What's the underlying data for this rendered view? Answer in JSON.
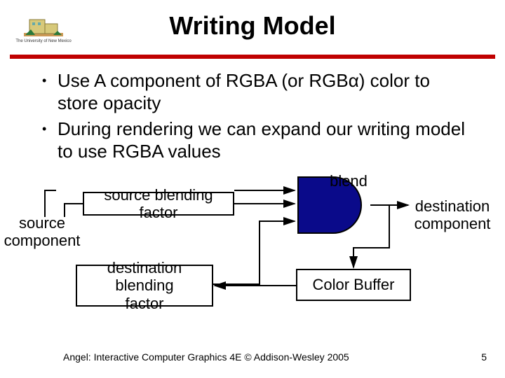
{
  "logo_caption": "The University of New Mexico",
  "title": "Writing Model",
  "bullets": [
    "Use A component of RGBA (or RGBα) color to store opacity",
    "During rendering we can expand our writing model to use RGBA values"
  ],
  "diagram": {
    "source_component": "source\ncomponent",
    "src_blend_box": "source blending factor",
    "dst_blend_box": "destination blending\nfactor",
    "blend_label": "blend",
    "destination_component": "destination\ncomponent",
    "color_buffer": "Color Buffer"
  },
  "footer": "Angel: Interactive Computer Graphics 4E © Addison-Wesley 2005",
  "page_number": "5"
}
